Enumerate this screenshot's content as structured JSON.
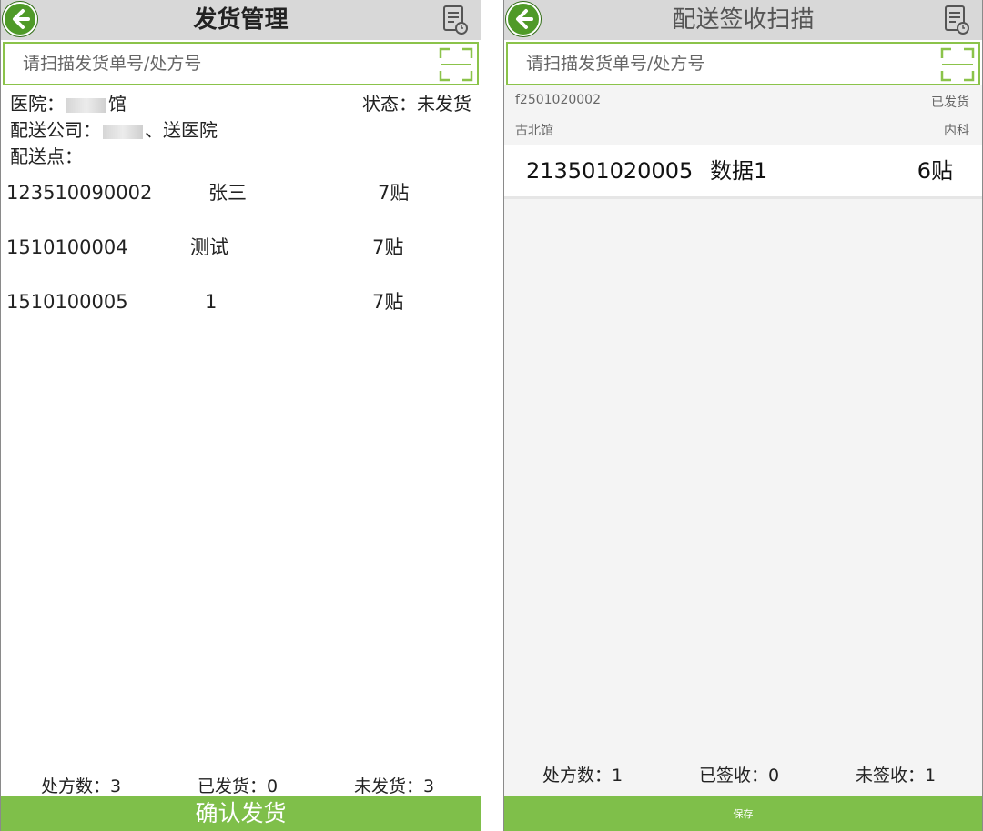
{
  "left": {
    "title": "发货管理",
    "search_placeholder": "请扫描发货单号/处方号",
    "hospital_label": "医院：",
    "hospital_suffix": "馆",
    "status": "状态：未发货",
    "company_label": "配送公司：",
    "company_suffix": "、送医院",
    "point_label": "配送点：",
    "rows": [
      {
        "id": "123510090002",
        "name": "张三",
        "qty": "7贴"
      },
      {
        "id": "1510100004",
        "name": "测试",
        "qty": "7贴"
      },
      {
        "id": "1510100005",
        "name": "1",
        "qty": "7贴"
      }
    ],
    "summary": {
      "total": "处方数：3",
      "shipped": "已发货：0",
      "unshipped": "未发货：3"
    },
    "confirm_label": "确认发货"
  },
  "right": {
    "title": "配送签收扫描",
    "search_placeholder": "请扫描发货单号/处方号",
    "order_no": "f2501020002",
    "order_status": "已发货",
    "hospital": "古北馆",
    "department": "内科",
    "item": {
      "id": "213501020005",
      "name": "数据1",
      "qty": "6贴"
    },
    "summary": {
      "total": "处方数：1",
      "signed": "已签收：0",
      "unsigned": "未签收：1"
    },
    "save_label": "保存"
  },
  "icons": {
    "back": "back-arrow-icon",
    "doc": "document-clock-icon",
    "scan": "scan-frame-icon"
  },
  "colors": {
    "accent_green": "#7fbf4a",
    "back_green": "#4f9a28",
    "header_grey": "#d8d8d8"
  }
}
